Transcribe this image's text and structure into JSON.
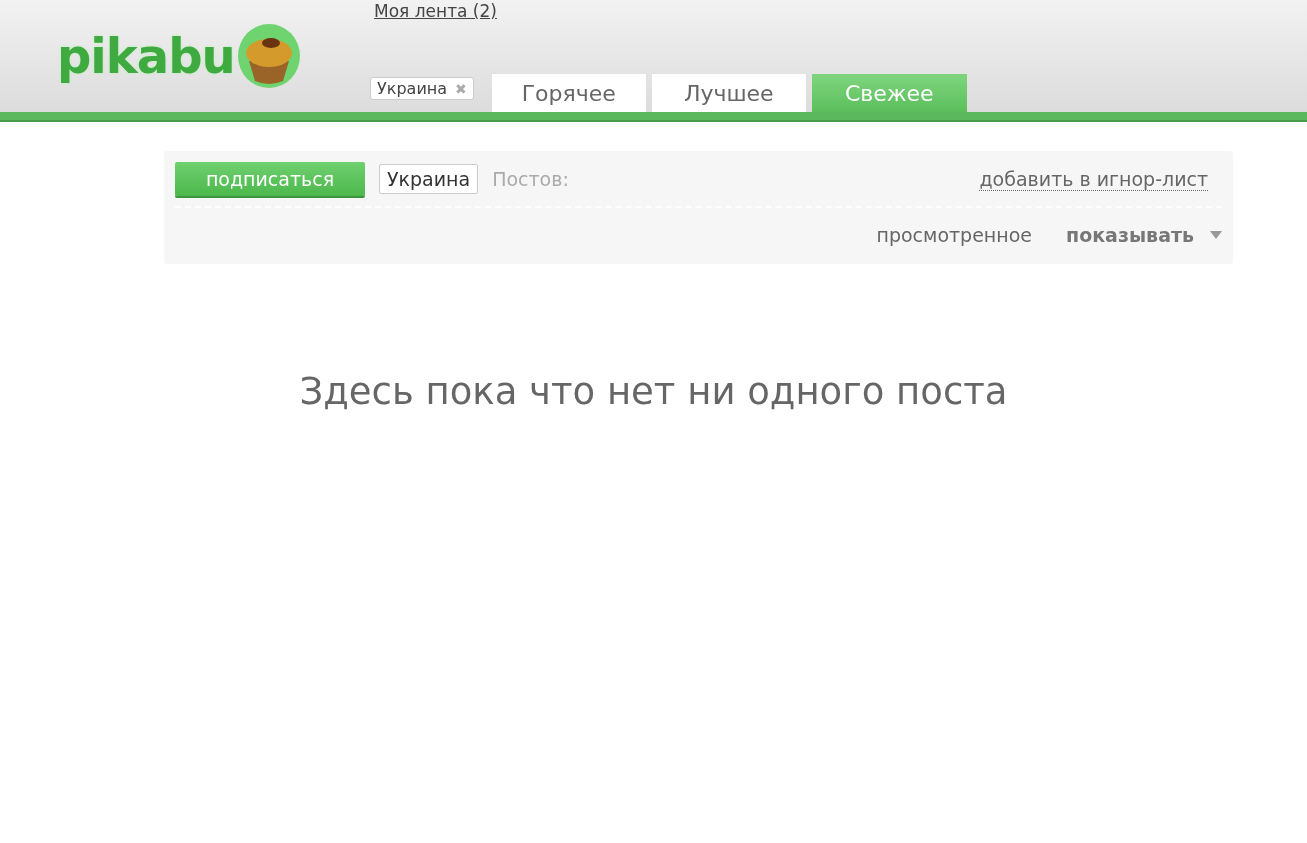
{
  "header": {
    "logo": "pikabu",
    "feed_link": "Моя лента (2)",
    "tag_filter": {
      "label": "Украина",
      "remove": "✖"
    },
    "tabs": [
      {
        "label": "Горячее",
        "selected": false
      },
      {
        "label": "Лучшее",
        "selected": false
      },
      {
        "label": "Свежее",
        "selected": true
      }
    ]
  },
  "tag_panel": {
    "subscribe_button": "подписаться",
    "tag": "Украина",
    "posts_label": "Постов:",
    "ignore_link": "добавить в игнор-лист",
    "viewed_label": "просмотренное",
    "viewed_option": "показывать"
  },
  "empty_message": "Здесь пока что нет ни одного поста"
}
